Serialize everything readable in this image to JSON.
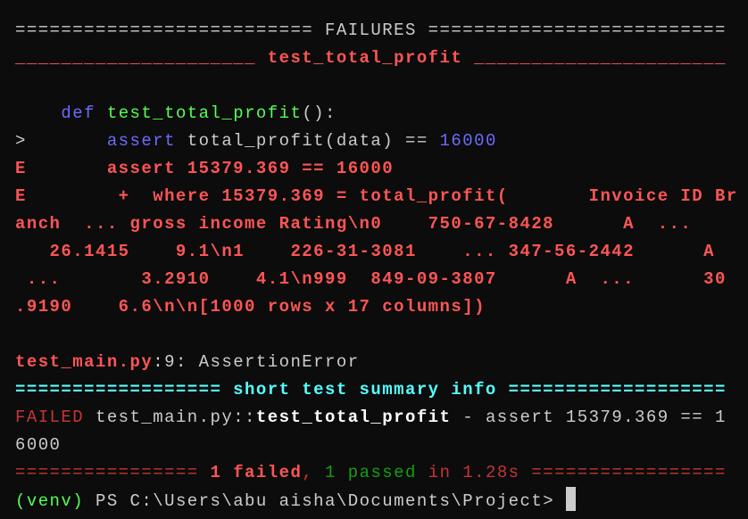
{
  "colors": {
    "default": "#cccccc",
    "red_bold": "#ff5555",
    "red_dark": "#c43535",
    "blue": "#6b6bff",
    "green": "#55ff55",
    "green_dark": "#13a10e",
    "cyan": "#55ffff",
    "white_bold": "#ffffff"
  },
  "terminal": {
    "lines": [
      {
        "name": "failures-header",
        "segments": [
          {
            "text": "========================== FAILURES ==========================",
            "color": "default"
          }
        ]
      },
      {
        "name": "test-section-header",
        "segments": [
          {
            "text": "_____________________ test_total_profit ______________________",
            "color": "red_bold",
            "bold": true
          }
        ]
      },
      {
        "name": "blank-line",
        "segments": []
      },
      {
        "name": "source-def-line",
        "segments": [
          {
            "text": "    ",
            "color": "default"
          },
          {
            "text": "def",
            "color": "blue"
          },
          {
            "text": " ",
            "color": "default"
          },
          {
            "text": "test_total_profit",
            "color": "green"
          },
          {
            "text": "():",
            "color": "default"
          }
        ]
      },
      {
        "name": "source-assert-line",
        "segments": [
          {
            "text": ">       ",
            "color": "default"
          },
          {
            "text": "assert",
            "color": "blue"
          },
          {
            "text": " total_profit(data) == ",
            "color": "default"
          },
          {
            "text": "16000",
            "color": "blue"
          }
        ]
      },
      {
        "name": "error-line",
        "segments": [
          {
            "text": "E       assert 15379.369 == 16000",
            "color": "red_bold",
            "bold": true
          }
        ]
      },
      {
        "name": "error-line",
        "segments": [
          {
            "text": "E        +  where 15379.369 = total_profit(       Invoice ID Br",
            "color": "red_bold",
            "bold": true
          }
        ]
      },
      {
        "name": "error-line",
        "segments": [
          {
            "text": "anch  ... gross income Rating\\n0    750-67-8428      A  ...",
            "color": "red_bold",
            "bold": true
          }
        ]
      },
      {
        "name": "error-line",
        "segments": [
          {
            "text": "   26.1415    9.1\\n1    226-31-3081    ... 347-56-2442      A",
            "color": "red_bold",
            "bold": true
          }
        ]
      },
      {
        "name": "error-line",
        "segments": [
          {
            "text": " ...       3.2910    4.1\\n999  849-09-3807      A  ...      30",
            "color": "red_bold",
            "bold": true
          }
        ]
      },
      {
        "name": "error-line",
        "segments": [
          {
            "text": ".9190    6.6\\n\\n[1000 rows x 17 columns])",
            "color": "red_bold",
            "bold": true
          }
        ]
      },
      {
        "name": "blank-line",
        "segments": []
      },
      {
        "name": "error-location-line",
        "segments": [
          {
            "text": "test_main.py",
            "color": "red_bold",
            "bold": true
          },
          {
            "text": ":9: AssertionError",
            "color": "default"
          }
        ]
      },
      {
        "name": "summary-header",
        "segments": [
          {
            "text": "================== short test summary info ===================",
            "color": "cyan",
            "bold": true
          }
        ]
      },
      {
        "name": "failed-summary-line",
        "segments": [
          {
            "text": "FAILED",
            "color": "red_dark"
          },
          {
            "text": " test_main.py::",
            "color": "default"
          },
          {
            "text": "test_total_profit",
            "color": "white_bold",
            "bold": true
          },
          {
            "text": " - assert 15379.369 == 1",
            "color": "default"
          }
        ]
      },
      {
        "name": "failed-summary-line",
        "segments": [
          {
            "text": "6000",
            "color": "default"
          }
        ]
      },
      {
        "name": "result-footer",
        "segments": [
          {
            "text": "================ ",
            "color": "red_dark"
          },
          {
            "text": "1 failed",
            "color": "red_bold",
            "bold": true
          },
          {
            "text": ", ",
            "color": "red_dark"
          },
          {
            "text": "1 passed",
            "color": "green_dark"
          },
          {
            "text": " in 1.28s ",
            "color": "red_dark"
          },
          {
            "text": "=================",
            "color": "red_dark"
          }
        ]
      },
      {
        "name": "prompt-line",
        "segments": [
          {
            "text": "(venv)",
            "color": "green"
          },
          {
            "text": " PS C:\\Users\\abu aisha\\Documents\\Project> ",
            "color": "default"
          }
        ],
        "cursor": true
      }
    ]
  }
}
